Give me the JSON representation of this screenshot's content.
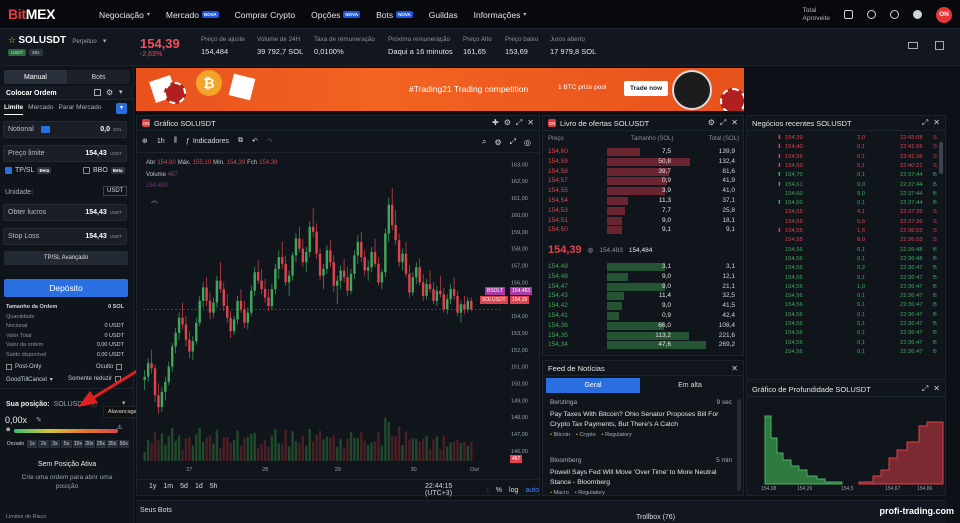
{
  "nav": {
    "logo_prefix": "Bit",
    "logo_suffix": "MEX",
    "items": [
      {
        "label": "Negociação",
        "caret": true
      },
      {
        "label": "Mercado",
        "tag": "NOVA"
      },
      {
        "label": "Comprar Crypto"
      },
      {
        "label": "Opções",
        "tag": "NOVA"
      },
      {
        "label": "Bots",
        "tag": "NOVA"
      },
      {
        "label": "Guildas"
      },
      {
        "label": "Informações",
        "caret": true
      }
    ],
    "total_line1": "Total",
    "total_line2": "Aproveite",
    "avatar": "ON"
  },
  "ticker": {
    "symbol": "SOLUSDT",
    "symbol_sub": "Perpétuo",
    "chip1": "USDT",
    "chip2": "50x",
    "last_price": "154,39",
    "change": "-2,63%",
    "stats": [
      {
        "label": "Preço de ajuste",
        "value": "154,484"
      },
      {
        "label": "Volume de 24H",
        "value": "39 792,7 SOL"
      },
      {
        "label": "Taxa de remuneração",
        "value": "0,0100%"
      },
      {
        "label": "Próxima remuneração",
        "value": "Daqui a 16 minutos"
      },
      {
        "label": "Preço Alto",
        "value": "161,65"
      },
      {
        "label": "Preço baixo",
        "value": "153,69"
      },
      {
        "label": "Juros aberto",
        "value": "17 979,8 SOL"
      }
    ]
  },
  "left": {
    "tab_manual": "Manual",
    "tab_bots": "Bots",
    "place_order": "Colocar Ordem",
    "order_types": [
      "Limite",
      "Mercado",
      "Parar Mercado"
    ],
    "notional_label": "Notional",
    "notional_value": "0,0",
    "notional_unit": "SOL",
    "price_label": "Preço limite",
    "price_value": "154,43",
    "price_unit": "USDT",
    "tpsl": "TP/SL",
    "tpsl_tag": "Beta",
    "bbo": "BBO",
    "bbo_tag": "Beta",
    "unit_label": "Unidade:",
    "unit_value": "USDT",
    "tp_label": "Obter lucros",
    "tp_value": "154,43",
    "tp_unit": "USDT",
    "sl_label": "Stop Loss",
    "sl_value": "154,43",
    "sl_unit": "USDT",
    "advanced": "TP/SL Avançado",
    "deposit": "Depósito",
    "details": [
      {
        "k": "Tamanho da Ordem",
        "v": "0 SOL"
      },
      {
        "k": "Quantidade",
        "v": ""
      },
      {
        "k": "Nocional",
        "v": "0 USDT"
      },
      {
        "k": "Valor Total",
        "v": "0 USDT"
      },
      {
        "k": "Valor da ordem",
        "v": "0,00 USDT"
      },
      {
        "k": "Saldo disponível",
        "v": "0,00 USDT"
      }
    ],
    "post_only": "Post-Only",
    "hidden": "Oculto",
    "gtc": "GoodTillCancel",
    "reduce_only": "Somente reduzir",
    "position_label": "Sua posição:",
    "position_symbol": "SOLUSDT",
    "leverage_value": "0,00x",
    "tooltip": "Alavancagem Máxima: 100x",
    "leverage_marks": [
      "Onzado",
      "1x",
      "2x",
      "3x",
      "5x",
      "10x",
      "20x",
      "25x",
      "35x",
      "50x"
    ],
    "no_position": "Sem Posição Ativa",
    "no_position_sub": "Crie uma ordem para abrir uma posição",
    "risk_limits": "Limites de Risco"
  },
  "banner": {
    "headline": "#Trading21 Trading competition",
    "pool": "1 BTC prize pool",
    "cta": "Trade now"
  },
  "chart": {
    "title": "Gráfico SOLUSDT",
    "interval": "1h",
    "indicators": "Indicadores",
    "ohlc": {
      "o_label": "Abr",
      "o": "154,90",
      "h_label": "Máx.",
      "h": "155,10",
      "l_label": "Mín.",
      "l": "154,39",
      "c_label": "Fch",
      "c": "154,39"
    },
    "volume_label": "Volume",
    "volume_value": "467",
    "volume_sub": "154,483",
    "tag_bsolt": "BSOLT",
    "tag_bsolt_val": "154,483",
    "tag_sol": "SOLUSDT",
    "tag_sol_val": "154,39",
    "tag_vol": "467",
    "footer_ranges": [
      "1y",
      "1m",
      "5d",
      "1d",
      "5h"
    ],
    "clock": "22:44:15 (UTC+3)",
    "pct": "%",
    "log": "log",
    "auto": "auto"
  },
  "chart_data": {
    "type": "candlestick",
    "x_tick_labels": [
      "27",
      "28",
      "29",
      "30",
      "Out"
    ],
    "y_tick_labels": [
      "163,00",
      "162,00",
      "161,00",
      "160,00",
      "159,00",
      "158,00",
      "157,00",
      "156,00",
      "155,00",
      "154,00",
      "153,00",
      "152,00",
      "151,00",
      "150,00",
      "149,00",
      "148,00",
      "147,00",
      "146,00"
    ],
    "ylim": [
      145.4,
      163.2
    ],
    "candles": [
      [
        150.2,
        150.8,
        149.6,
        150.4
      ],
      [
        150.4,
        151.5,
        150.1,
        151.2
      ],
      [
        151.2,
        152.0,
        150.6,
        150.9
      ],
      [
        150.9,
        151.1,
        148.9,
        149.3
      ],
      [
        149.3,
        150.0,
        148.2,
        148.6
      ],
      [
        148.6,
        149.8,
        148.3,
        149.5
      ],
      [
        149.5,
        150.4,
        149.0,
        150.1
      ],
      [
        150.1,
        151.3,
        149.9,
        151.0
      ],
      [
        151.0,
        152.4,
        150.7,
        152.2
      ],
      [
        152.2,
        153.3,
        151.8,
        153.0
      ],
      [
        153.0,
        154.2,
        152.6,
        153.9
      ],
      [
        153.9,
        154.8,
        153.2,
        153.5
      ],
      [
        153.5,
        154.0,
        152.2,
        152.6
      ],
      [
        152.6,
        153.1,
        151.5,
        151.9
      ],
      [
        151.9,
        152.8,
        151.4,
        152.5
      ],
      [
        152.5,
        153.9,
        152.3,
        153.6
      ],
      [
        153.6,
        155.2,
        153.4,
        154.9
      ],
      [
        154.9,
        156.0,
        154.5,
        155.7
      ],
      [
        155.7,
        156.3,
        154.6,
        154.9
      ],
      [
        154.9,
        155.4,
        153.8,
        154.2
      ],
      [
        154.2,
        155.1,
        153.9,
        154.8
      ],
      [
        154.8,
        156.4,
        154.5,
        156.1
      ],
      [
        156.1,
        157.2,
        155.4,
        155.6
      ],
      [
        155.6,
        156.0,
        154.3,
        154.6
      ],
      [
        154.6,
        155.3,
        153.6,
        153.9
      ],
      [
        153.9,
        154.3,
        152.7,
        153.1
      ],
      [
        153.1,
        154.0,
        152.9,
        153.8
      ],
      [
        153.8,
        155.2,
        153.5,
        154.9
      ],
      [
        154.9,
        155.6,
        154.2,
        154.4
      ],
      [
        154.4,
        154.9,
        153.3,
        153.6
      ],
      [
        153.6,
        154.5,
        153.2,
        154.2
      ],
      [
        154.2,
        155.8,
        154.0,
        155.5
      ],
      [
        155.5,
        156.9,
        155.2,
        156.6
      ],
      [
        156.6,
        157.3,
        155.9,
        156.1
      ],
      [
        156.1,
        156.8,
        155.3,
        155.6
      ],
      [
        155.6,
        156.2,
        154.8,
        155.1
      ],
      [
        155.1,
        155.6,
        154.3,
        154.6
      ],
      [
        154.6,
        155.9,
        154.4,
        155.6
      ],
      [
        155.6,
        157.1,
        155.3,
        156.8
      ],
      [
        156.8,
        157.9,
        156.2,
        157.5
      ],
      [
        157.5,
        158.4,
        156.8,
        157.1
      ],
      [
        157.1,
        157.6,
        155.8,
        156.0
      ],
      [
        156.0,
        156.7,
        155.2,
        156.4
      ],
      [
        156.4,
        157.8,
        156.1,
        157.6
      ],
      [
        157.6,
        158.9,
        157.2,
        158.6
      ],
      [
        158.6,
        159.3,
        157.8,
        158.0
      ],
      [
        158.0,
        158.6,
        156.9,
        157.2
      ],
      [
        157.2,
        158.1,
        156.6,
        157.8
      ],
      [
        157.8,
        159.6,
        157.5,
        159.3
      ],
      [
        159.3,
        160.4,
        158.7,
        159.0
      ],
      [
        159.0,
        159.5,
        157.4,
        157.7
      ],
      [
        157.7,
        158.0,
        156.1,
        156.4
      ],
      [
        156.4,
        157.1,
        155.6,
        156.8
      ],
      [
        156.8,
        158.2,
        156.5,
        157.9
      ],
      [
        157.9,
        158.5,
        156.9,
        157.2
      ],
      [
        157.2,
        157.6,
        155.4,
        155.8
      ],
      [
        155.8,
        156.4,
        154.7,
        156.1
      ],
      [
        156.1,
        157.0,
        155.6,
        156.7
      ],
      [
        156.7,
        157.4,
        156.0,
        156.3
      ],
      [
        156.3,
        156.9,
        155.2,
        155.5
      ],
      [
        155.5,
        156.8,
        155.3,
        156.5
      ],
      [
        156.5,
        157.9,
        156.2,
        157.6
      ],
      [
        157.6,
        158.8,
        157.1,
        158.4
      ],
      [
        158.4,
        159.0,
        157.2,
        157.5
      ],
      [
        157.5,
        157.9,
        156.4,
        156.7
      ],
      [
        156.7,
        157.3,
        156.1,
        156.9
      ],
      [
        156.9,
        158.1,
        156.6,
        157.8
      ],
      [
        157.8,
        158.6,
        156.9,
        157.1
      ],
      [
        157.1,
        157.5,
        155.8,
        156.0
      ],
      [
        156.0,
        156.8,
        155.6,
        156.6
      ],
      [
        156.6,
        159.2,
        156.3,
        158.9
      ],
      [
        158.9,
        161.0,
        158.4,
        160.6
      ],
      [
        160.6,
        161.6,
        159.1,
        159.4
      ],
      [
        159.4,
        160.3,
        158.2,
        158.5
      ],
      [
        158.5,
        158.9,
        156.9,
        157.2
      ],
      [
        157.2,
        158.0,
        156.7,
        157.7
      ],
      [
        157.7,
        158.4,
        156.3,
        156.5
      ],
      [
        156.5,
        157.0,
        155.1,
        155.4
      ],
      [
        155.4,
        156.6,
        155.2,
        156.3
      ],
      [
        156.3,
        157.2,
        155.9,
        156.9
      ],
      [
        156.9,
        157.4,
        155.8,
        156.0
      ],
      [
        156.0,
        156.5,
        154.9,
        155.2
      ],
      [
        155.2,
        156.2,
        155.0,
        155.9
      ],
      [
        155.9,
        156.7,
        155.4,
        155.6
      ],
      [
        155.6,
        156.0,
        154.7,
        154.9
      ],
      [
        154.9,
        155.8,
        154.6,
        155.5
      ],
      [
        155.5,
        156.4,
        155.1,
        155.3
      ],
      [
        155.3,
        155.7,
        154.2,
        154.4
      ],
      [
        154.4,
        155.3,
        154.1,
        155.0
      ],
      [
        155.0,
        155.9,
        154.7,
        155.6
      ],
      [
        155.6,
        156.3,
        155.0,
        155.2
      ],
      [
        155.2,
        155.5,
        154.0,
        154.2
      ],
      [
        154.2,
        154.9,
        153.6,
        154.7
      ],
      [
        154.7,
        155.2,
        154.1,
        154.4
      ],
      [
        154.4,
        155.1,
        154.2,
        154.9
      ],
      [
        154.9,
        155.1,
        154.3,
        154.39
      ]
    ]
  },
  "orderbook": {
    "title": "Livro de ofertas SOLUSDT",
    "headers": [
      "Preço",
      "Tamanho (SOL)",
      "Total (SOL)"
    ],
    "asks": [
      {
        "p": "154,60",
        "s": "7,5",
        "t": "139,9",
        "depth": 0.32
      },
      {
        "p": "154,59",
        "s": "50,8",
        "t": "132,4",
        "depth": 0.8
      },
      {
        "p": "154,58",
        "s": "39,7",
        "t": "81,6",
        "depth": 0.6
      },
      {
        "p": "154,57",
        "s": "0,9",
        "t": "41,9",
        "depth": 0.58
      },
      {
        "p": "154,55",
        "s": "3,9",
        "t": "41,0",
        "depth": 0.56
      },
      {
        "p": "154,54",
        "s": "11,3",
        "t": "37,1",
        "depth": 0.2
      },
      {
        "p": "154,53",
        "s": "7,7",
        "t": "25,8",
        "depth": 0.17
      },
      {
        "p": "154,51",
        "s": "9,0",
        "t": "18,1",
        "depth": 0.14
      },
      {
        "p": "154,50",
        "s": "9,1",
        "t": "9,1",
        "depth": 0.14
      }
    ],
    "mid_price": "154,39",
    "mid_mark": "154,483",
    "mid_index": "154,484",
    "bids": [
      {
        "p": "154,49",
        "s": "3,1",
        "t": "3,1",
        "depth": 0.56
      },
      {
        "p": "154,48",
        "s": "9,0",
        "t": "12,1",
        "depth": 0.2
      },
      {
        "p": "154,47",
        "s": "9,0",
        "t": "21,1",
        "depth": 0.56
      },
      {
        "p": "154,43",
        "s": "11,4",
        "t": "32,5",
        "depth": 0.16
      },
      {
        "p": "154,42",
        "s": "9,0",
        "t": "41,5",
        "depth": 0.14
      },
      {
        "p": "154,41",
        "s": "0,9",
        "t": "42,4",
        "depth": 0.12
      },
      {
        "p": "154,36",
        "s": "66,0",
        "t": "108,4",
        "depth": 0.55
      },
      {
        "p": "154,35",
        "s": "113,2",
        "t": "221,6",
        "depth": 0.79
      },
      {
        "p": "154,34",
        "s": "47,6",
        "t": "269,2",
        "depth": 0.95
      }
    ]
  },
  "trades": {
    "title": "Negócios recentes SOLUSDT",
    "rows": [
      {
        "dir": "down",
        "p": "154,39",
        "q": "2,0",
        "t": "22:43:08",
        "s": "S"
      },
      {
        "dir": "down",
        "p": "154,40",
        "q": "0,1",
        "t": "22:41:56",
        "s": "S"
      },
      {
        "dir": "down",
        "p": "154,55",
        "q": "0,1",
        "t": "22:41:36",
        "s": "S"
      },
      {
        "dir": "down",
        "p": "154,60",
        "q": "0,1",
        "t": "22:40:21",
        "s": "S"
      },
      {
        "dir": "up",
        "p": "154,70",
        "q": "0,1",
        "t": "22:37:44",
        "s": "B"
      },
      {
        "dir": "up",
        "p": "154,61",
        "q": "9,0",
        "t": "22:37:44",
        "s": "B"
      },
      {
        "dir": "none",
        "p": "154,60",
        "q": "9,0",
        "t": "22:37:44",
        "s": "B"
      },
      {
        "dir": "up",
        "p": "154,60",
        "q": "0,1",
        "t": "22:37:44",
        "s": "B"
      },
      {
        "dir": "none",
        "p": "154,55",
        "q": "4,1",
        "t": "22:37:36",
        "s": "S"
      },
      {
        "dir": "none",
        "p": "154,55",
        "q": "5,6",
        "t": "22:37:36",
        "s": "S"
      },
      {
        "dir": "down",
        "p": "154,55",
        "q": "1,6",
        "t": "22:36:53",
        "s": "S"
      },
      {
        "dir": "none",
        "p": "154,55",
        "q": "8,0",
        "t": "22:36:53",
        "s": "S"
      },
      {
        "dir": "none",
        "p": "154,56",
        "q": "0,1",
        "t": "22:36:48",
        "s": "B"
      },
      {
        "dir": "none",
        "p": "154,56",
        "q": "0,1",
        "t": "22:36:48",
        "s": "B"
      },
      {
        "dir": "none",
        "p": "154,56",
        "q": "0,2",
        "t": "22:36:47",
        "s": "B"
      },
      {
        "dir": "none",
        "p": "154,56",
        "q": "0,1",
        "t": "22:36:47",
        "s": "B"
      },
      {
        "dir": "none",
        "p": "154,56",
        "q": "1,0",
        "t": "22:36:47",
        "s": "B"
      },
      {
        "dir": "none",
        "p": "154,56",
        "q": "0,1",
        "t": "22:36:47",
        "s": "B"
      },
      {
        "dir": "none",
        "p": "154,56",
        "q": "0,1",
        "t": "22:36:47",
        "s": "B"
      },
      {
        "dir": "none",
        "p": "154,56",
        "q": "0,1",
        "t": "22:36:47",
        "s": "B"
      },
      {
        "dir": "none",
        "p": "154,56",
        "q": "0,1",
        "t": "22:36:47",
        "s": "B"
      },
      {
        "dir": "none",
        "p": "154,56",
        "q": "0,1",
        "t": "22:36:47",
        "s": "B"
      },
      {
        "dir": "none",
        "p": "154,56",
        "q": "0,1",
        "t": "22:36:47",
        "s": "B"
      },
      {
        "dir": "none",
        "p": "154,56",
        "q": "0,1",
        "t": "22:36:47",
        "s": "B"
      }
    ]
  },
  "news": {
    "title": "Feed de Notícias",
    "tab_general": "Geral",
    "tab_high": "Em alta",
    "items": [
      {
        "source": "Benzinga",
        "age": "9 sec",
        "headline": "Pay Taxes With Bitcoin? Ohio Senator Proposes Bill For Crypto Tax Payments, But There's A Catch",
        "tags": [
          "Bitcoin",
          "Crypto",
          "Regulatory"
        ]
      },
      {
        "source": "Bloomberg",
        "age": "5 min",
        "headline": "Powell Says Fed Will Move 'Over Time' to More Neutral Stance - Bloomberg",
        "tags": [
          "Macro",
          "Regulatory"
        ]
      }
    ]
  },
  "depth": {
    "title": "Gráfico de Profundidade SOLUSDT",
    "x_labels": [
      "154,08",
      "154,29",
      "154,5",
      "154,67",
      "154,86"
    ]
  },
  "bottom": {
    "bots": "Seus Bots",
    "trollbox": "Trollbox (76)",
    "watermark": "profi-trading.com"
  },
  "colors": {
    "bg": "#0d1117",
    "panel": "#10141b",
    "up": "#3fa85b",
    "down": "#e0434e",
    "accent": "#2a6fe0",
    "brand_red": "#e13d43"
  }
}
